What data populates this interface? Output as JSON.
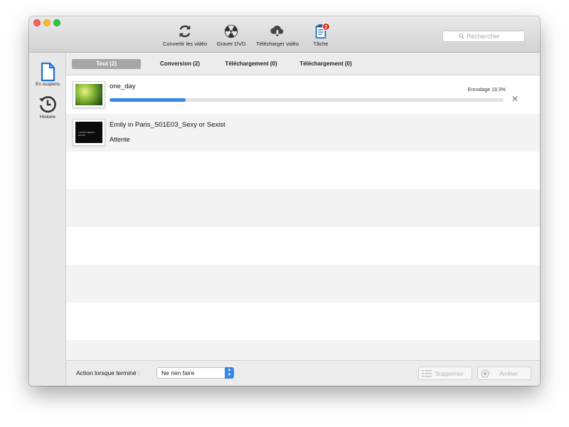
{
  "toolbar": {
    "tools": [
      {
        "label": "Convertir les vidéo",
        "icon": "refresh-icon"
      },
      {
        "label": "Graver DVD",
        "icon": "radiation-disc-icon"
      },
      {
        "label": "Télécharger vidéo",
        "icon": "cloud-download-icon"
      },
      {
        "label": "Tâche",
        "icon": "clipboard-task-icon",
        "badge": "2"
      }
    ],
    "search_placeholder": "Rechercher"
  },
  "sidebar": {
    "items": [
      {
        "label": "En suspens",
        "icon": "document-icon"
      },
      {
        "label": "Histoire",
        "icon": "history-clock-icon"
      }
    ]
  },
  "tabs": [
    {
      "label": "Tout (2)",
      "active": true
    },
    {
      "label": "Conversion (2)"
    },
    {
      "label": "Téléchargement (0)"
    },
    {
      "label": "Téléchargement (0)"
    }
  ],
  "tasks": [
    {
      "title": "one_day",
      "progress_label": "Encodage 19.3%",
      "progress": 0.193
    },
    {
      "title": "Emily in Paris_S01E03_Sexy or Sexist",
      "status": "Attente",
      "thumb_text": "LISTEN BEING GOOD"
    }
  ],
  "footer": {
    "label": "Action lorsque terminé :",
    "select_value": "Ne rien faire",
    "delete_label": "Supprimer",
    "stop_label": "Arrêter"
  },
  "colors": {
    "accent": "#3a86e6",
    "badge": "#e0231f",
    "active_tab": "#a6a6a6"
  }
}
